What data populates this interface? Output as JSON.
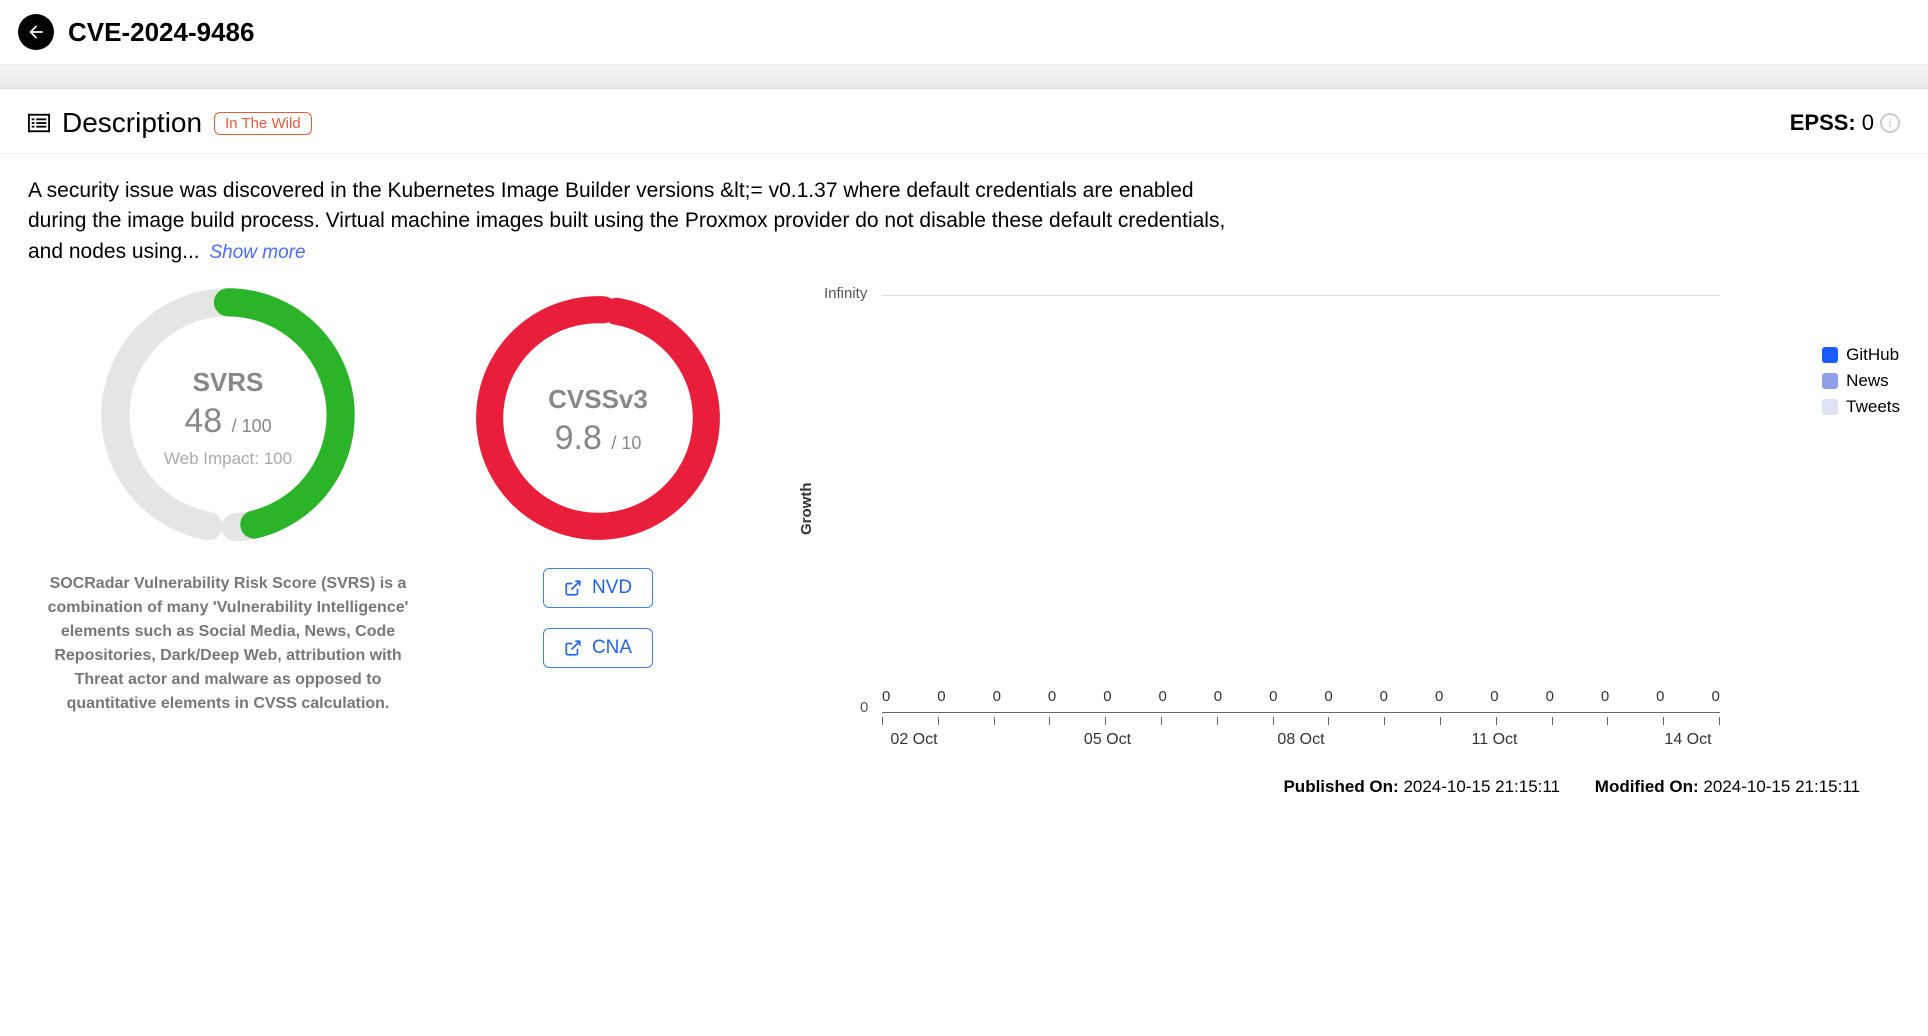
{
  "header": {
    "title": "CVE-2024-9486"
  },
  "section": {
    "title": "Description",
    "badge": "In The Wild",
    "epss_label": "EPSS:",
    "epss_value": "0"
  },
  "description": {
    "text": "A security issue was discovered in the Kubernetes Image Builder versions &lt;= v0.1.37 where default credentials are enabled during the image build process. Virtual machine images built using the Proxmox provider do not disable these default credentials, and nodes using...",
    "show_more": "Show more"
  },
  "svrs": {
    "title": "SVRS",
    "value": "48",
    "of": "/ 100",
    "sub": "Web Impact: 100",
    "desc": "SOCRadar Vulnerability Risk Score (SVRS) is a combination of many 'Vulnerability Intelligence' elements such as Social Media, News, Code Repositories, Dark/Deep Web, attribution with Threat actor and malware as opposed to quantitative elements in CVSS calculation."
  },
  "cvss": {
    "title": "CVSSv3",
    "value": "9.8",
    "of": "/ 10",
    "links": {
      "nvd": "NVD",
      "cna": "CNA"
    }
  },
  "chart_data": {
    "type": "line",
    "ylabel": "Growth",
    "y_top": "Infinity",
    "y_bottom": "0",
    "points": [
      "0",
      "0",
      "0",
      "0",
      "0",
      "0",
      "0",
      "0",
      "0",
      "0",
      "0",
      "0",
      "0",
      "0",
      "0",
      "0"
    ],
    "x_ticks": [
      "02 Oct",
      "05 Oct",
      "08 Oct",
      "11 Oct",
      "14 Oct"
    ],
    "legend": [
      {
        "name": "GitHub",
        "color": "#1a5cff"
      },
      {
        "name": "News",
        "color": "#8fa0e8"
      },
      {
        "name": "Tweets",
        "color": "#dfe2f5"
      }
    ]
  },
  "footer": {
    "pub_label": "Published On:",
    "pub_value": "2024-10-15 21:15:11",
    "mod_label": "Modified On:",
    "mod_value": "2024-10-15 21:15:11"
  }
}
